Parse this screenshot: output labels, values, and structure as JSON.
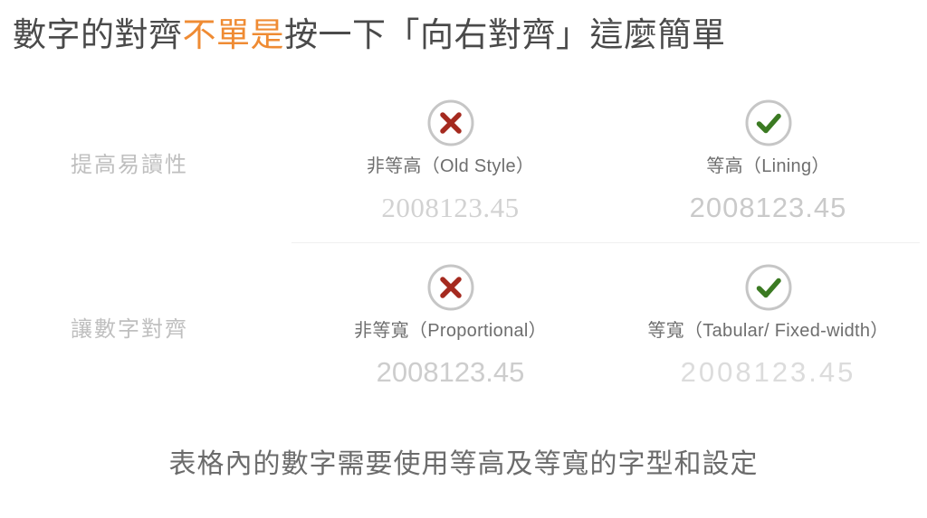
{
  "title": {
    "lead": "數字的對齊",
    "highlight": "不單是",
    "tail": "按一下「向右對齊」這麼簡單",
    "highlight_color": "#ef8b33",
    "text_color": "#4a4a4a"
  },
  "icons": {
    "cross": "cross-circle-icon",
    "check": "check-circle-icon",
    "cross_color": "#a52a1f",
    "check_color": "#3b7a22",
    "circle_color": "#c6c6c6"
  },
  "rows": [
    {
      "label": "提高易讀性",
      "cells": [
        {
          "status": "bad",
          "caption": "非等高（Old Style）",
          "figure": "2008123.45",
          "figure_style": "oldstyle"
        },
        {
          "status": "good",
          "caption": "等高（Lining）",
          "figure": "2008123.45",
          "figure_style": "lining"
        }
      ]
    },
    {
      "label": "讓數字對齊",
      "cells": [
        {
          "status": "bad",
          "caption": "非等寬（Proportional）",
          "figure": "2008123.45",
          "figure_style": "proportional"
        },
        {
          "status": "good",
          "caption": "等寬（Tabular/ Fixed-width）",
          "figure": "2008123.45",
          "figure_style": "tabular"
        }
      ]
    }
  ],
  "footnote": "表格內的數字需要使用等高及等寬的字型和設定"
}
